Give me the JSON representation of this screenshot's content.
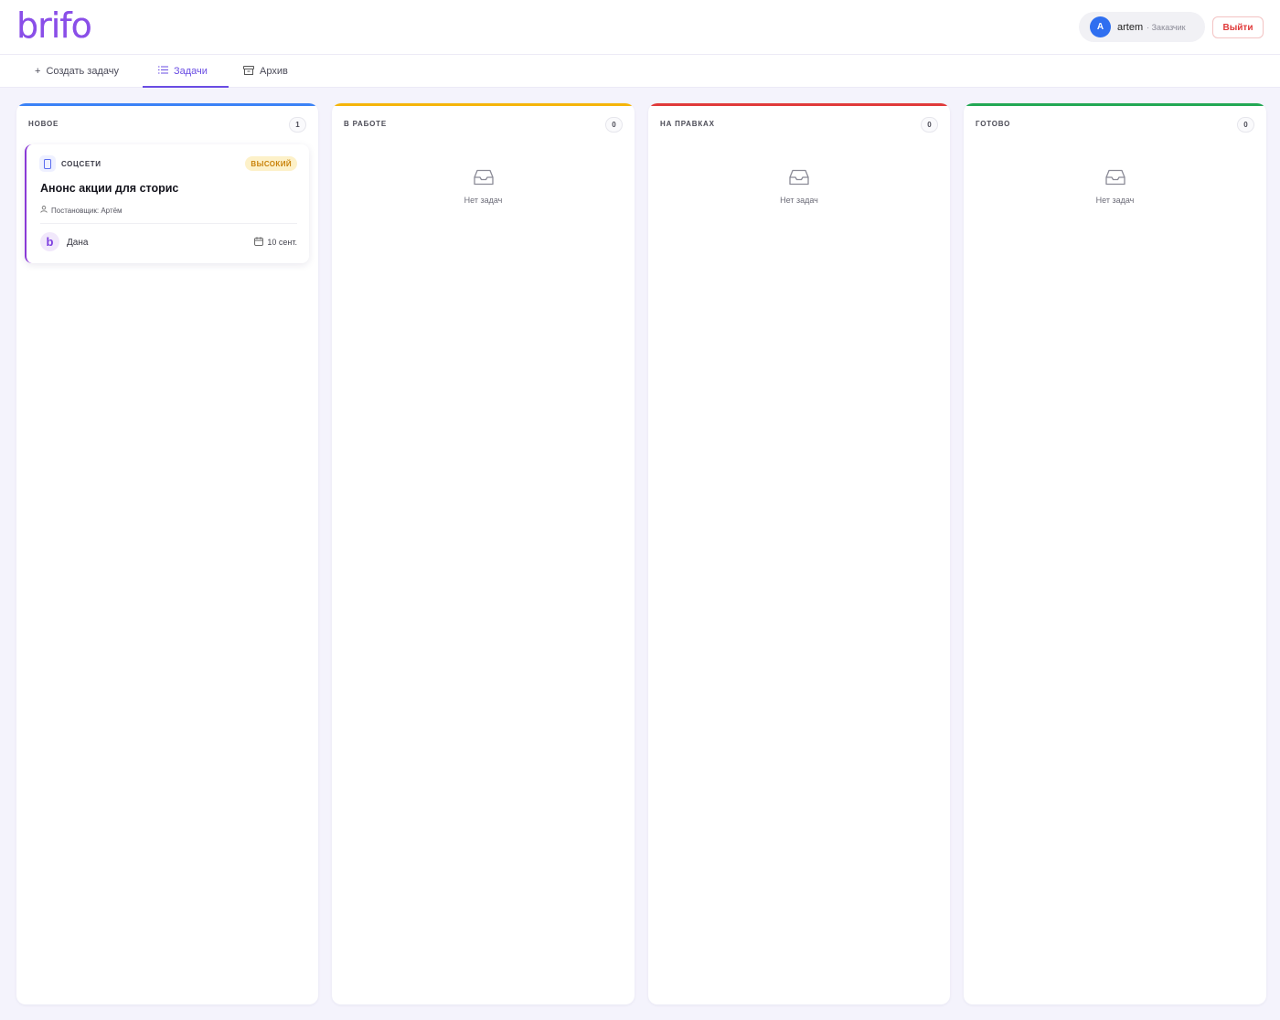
{
  "app": {
    "logo": "brifo",
    "brand_color": "#8a4fe8"
  },
  "user": {
    "initial": "A",
    "name": "artem",
    "role": "· Заказчик",
    "logout_label": "Выйти"
  },
  "tabs": [
    {
      "label": "Создать задачу",
      "icon": "plus-icon",
      "active": false
    },
    {
      "label": "Задачи",
      "icon": "list-icon",
      "active": true
    },
    {
      "label": "Архив",
      "icon": "archive-icon",
      "active": false
    }
  ],
  "columns": [
    {
      "title": "НОВОЕ",
      "count": "1",
      "color": "#3b82f6"
    },
    {
      "title": "В РАБОТЕ",
      "count": "0",
      "color": "#f5b50a",
      "empty_text": "Нет задач"
    },
    {
      "title": "НА ПРАВКАХ",
      "count": "0",
      "color": "#e03a3a",
      "empty_text": "Нет задач"
    },
    {
      "title": "ГОТОВО",
      "count": "0",
      "color": "#22a854",
      "empty_text": "Нет задач"
    }
  ],
  "card": {
    "category": "СОЦСЕТИ",
    "priority": "ВЫСОКИЙ",
    "title": "Анонс акции для сторис",
    "assigner": "Постановщик: Артём",
    "assignee_initial": "b",
    "assignee": "Дана",
    "due_date": "10 сент."
  }
}
